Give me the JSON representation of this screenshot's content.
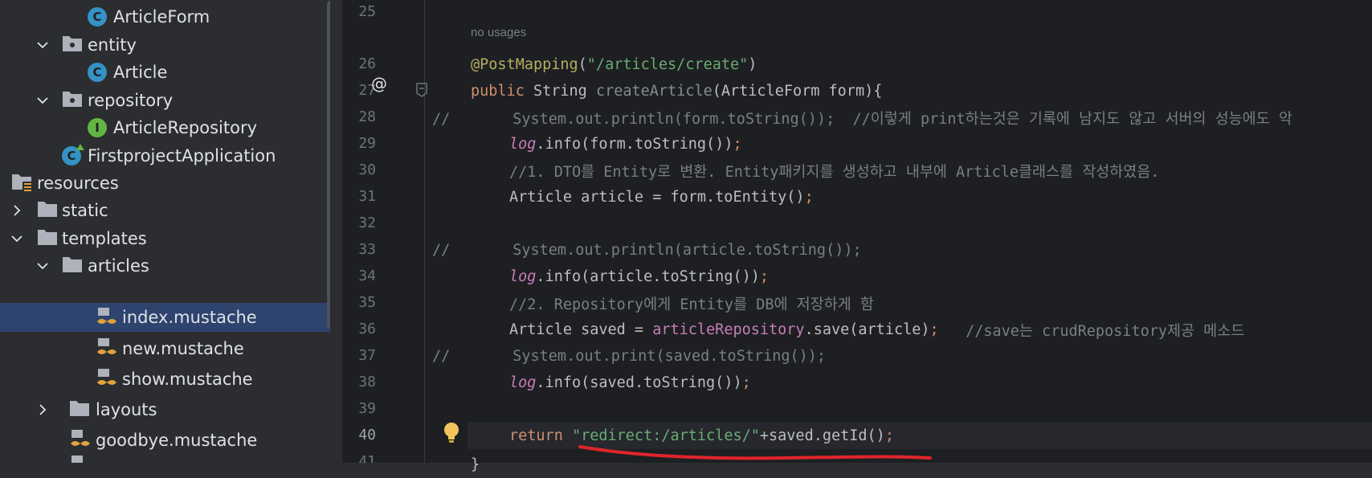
{
  "tree": {
    "items": [
      {
        "label": "ArticleForm",
        "icon": "class-icon",
        "type": "class"
      },
      {
        "label": "entity",
        "icon": "package-folder-icon",
        "type": "package",
        "expanded": true
      },
      {
        "label": "Article",
        "icon": "class-icon",
        "type": "class"
      },
      {
        "label": "repository",
        "icon": "package-folder-icon",
        "type": "package",
        "expanded": true
      },
      {
        "label": "ArticleRepository",
        "icon": "interface-icon",
        "type": "interface"
      },
      {
        "label": "FirstprojectApplication",
        "icon": "spring-class-icon",
        "type": "class"
      },
      {
        "label": "resources",
        "icon": "resources-folder-icon",
        "type": "folder"
      },
      {
        "label": "static",
        "icon": "folder-icon",
        "type": "folder",
        "expanded": false
      },
      {
        "label": "templates",
        "icon": "folder-icon",
        "type": "folder",
        "expanded": true
      },
      {
        "label": "articles",
        "icon": "folder-icon",
        "type": "folder",
        "expanded": true
      },
      {
        "label": "index.mustache",
        "icon": "mustache-file-icon",
        "type": "file",
        "selected": true
      },
      {
        "label": "new.mustache",
        "icon": "mustache-file-icon",
        "type": "file"
      },
      {
        "label": "show.mustache",
        "icon": "mustache-file-icon",
        "type": "file"
      },
      {
        "label": "layouts",
        "icon": "folder-icon",
        "type": "folder",
        "expanded": false
      },
      {
        "label": "goodbye.mustache",
        "icon": "mustache-file-icon",
        "type": "file"
      }
    ]
  },
  "editor": {
    "usage_hint": "no usages",
    "line_numbers": [
      "25",
      "26",
      "27",
      "28",
      "29",
      "30",
      "31",
      "32",
      "33",
      "34",
      "35",
      "36",
      "37",
      "38",
      "39",
      "40",
      "41"
    ],
    "lines": {
      "l26_ann": "@PostMapping",
      "l26_p1": "(",
      "l26_str": "\"/articles/create\"",
      "l26_p2": ")",
      "l27_kw": "public",
      "l27_type": " String ",
      "l27_fn": "createArticle",
      "l27_rest": "(ArticleForm form){",
      "l28_cmt": "//       System.out.println(form.toString());  //이렇게 print하는것은 기록에 남지도 않고 서버의 성능에도 악",
      "l29_log": "log",
      "l29_rest": ".info(form.toString())",
      "l29_semi": ";",
      "l30_cmt": "//1. DTO를 Entity로 변환. Entity패키지를 생성하고 내부에 Article클래스를 작성하였음.",
      "l31_code": "Article article = form.toEntity()",
      "l31_semi": ";",
      "l33_cmt": "//       System.out.println(article.toString());",
      "l34_log": "log",
      "l34_rest": ".info(article.toString())",
      "l34_semi": ";",
      "l35_cmt": "//2. Repository에게 Entity를 DB에 저장하게 함",
      "l36_code1": "Article saved = ",
      "l36_fld": "articleRepository",
      "l36_code2": ".save(article)",
      "l36_semi": ";",
      "l36_cmt": "   //save는 crudRepository제공 메소드",
      "l37_cmt": "//       System.out.print(saved.toString());",
      "l38_log": "log",
      "l38_rest": ".info(saved.toString())",
      "l38_semi": ";",
      "l40_kw": "return ",
      "l40_str": "\"redirect:/articles/\"",
      "l40_rest": "+saved.getId()",
      "l40_semi": ";",
      "l41_brace": "}"
    }
  },
  "colors": {
    "keyword": "#cf8e6d",
    "annotation": "#b3ae60",
    "string": "#6aab73",
    "comment": "#7a7e85",
    "method": "#56a8f5",
    "field": "#c77dbb",
    "selection": "#2e436e",
    "underline": "#e0252b"
  }
}
